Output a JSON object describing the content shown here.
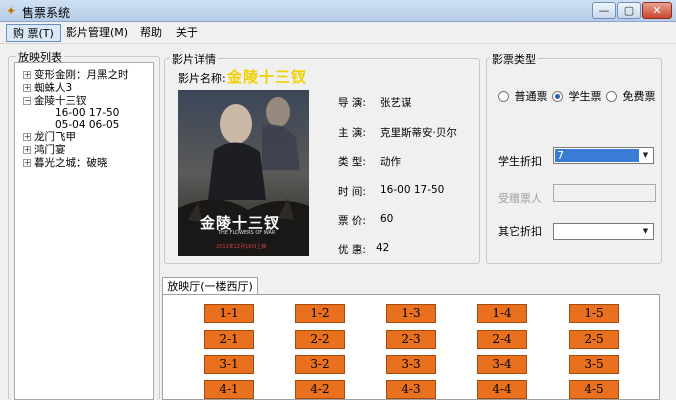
{
  "window": {
    "title": "售票系统",
    "minimize": "—",
    "maximize": "▢",
    "close": "✕"
  },
  "menu": {
    "items": [
      "购 票(T)",
      "影片管理(M)",
      "帮助",
      "关于"
    ]
  },
  "tree": {
    "legend": "放映列表",
    "nodes": [
      {
        "label": "变形金刚：月黑之时",
        "expander": "+"
      },
      {
        "label": "蜘蛛人3",
        "expander": "+"
      },
      {
        "label": "金陵十三钗",
        "expander": "−"
      },
      {
        "label": "16-00 17-50",
        "expander": ""
      },
      {
        "label": "05-04 06-05",
        "expander": ""
      },
      {
        "label": "龙门飞甲",
        "expander": "+"
      },
      {
        "label": "鸿门宴",
        "expander": "+"
      },
      {
        "label": "暮光之城：破晓",
        "expander": "+"
      }
    ]
  },
  "film": {
    "legend": "影片详情",
    "name_label": "影片名称:",
    "name_value": "金陵十三钗",
    "poster_title": "金陵十三钗",
    "poster_sub": "THE FLOWERS OF WAR",
    "poster_date": "2011年12月16日上映",
    "fields": [
      {
        "label": "导  演:",
        "value": "张艺谋"
      },
      {
        "label": "主  演:",
        "value": "克里斯蒂安·贝尔"
      },
      {
        "label": "类  型:",
        "value": "动作"
      },
      {
        "label": "时  间:",
        "value": "16-00 17-50"
      },
      {
        "label": "票  价:",
        "value": "60"
      },
      {
        "label": "优  惠:",
        "value": "42"
      }
    ]
  },
  "ticket_type": {
    "legend": "影票类型",
    "options": [
      "普通票",
      "学生票",
      "免费票"
    ],
    "selected": "学生票",
    "student_discount_label": "学生折扣",
    "student_discount_value": "7",
    "gift_person_label": "受赠票人",
    "other_discount_label": "其它折扣",
    "other_discount_value": ""
  },
  "hall": {
    "tab_label": "放映厅(一楼西厅)",
    "seats": [
      [
        "1-1",
        "1-2",
        "1-3",
        "1-4",
        "1-5"
      ],
      [
        "2-1",
        "2-2",
        "2-3",
        "2-4",
        "2-5"
      ],
      [
        "3-1",
        "3-2",
        "3-3",
        "3-4",
        "3-5"
      ],
      [
        "4-1",
        "4-2",
        "4-3",
        "4-4",
        "4-5"
      ]
    ]
  },
  "colors": {
    "accent_title": "#f0d000",
    "seat": "#e8701e",
    "selection": "#3a7bd5"
  }
}
